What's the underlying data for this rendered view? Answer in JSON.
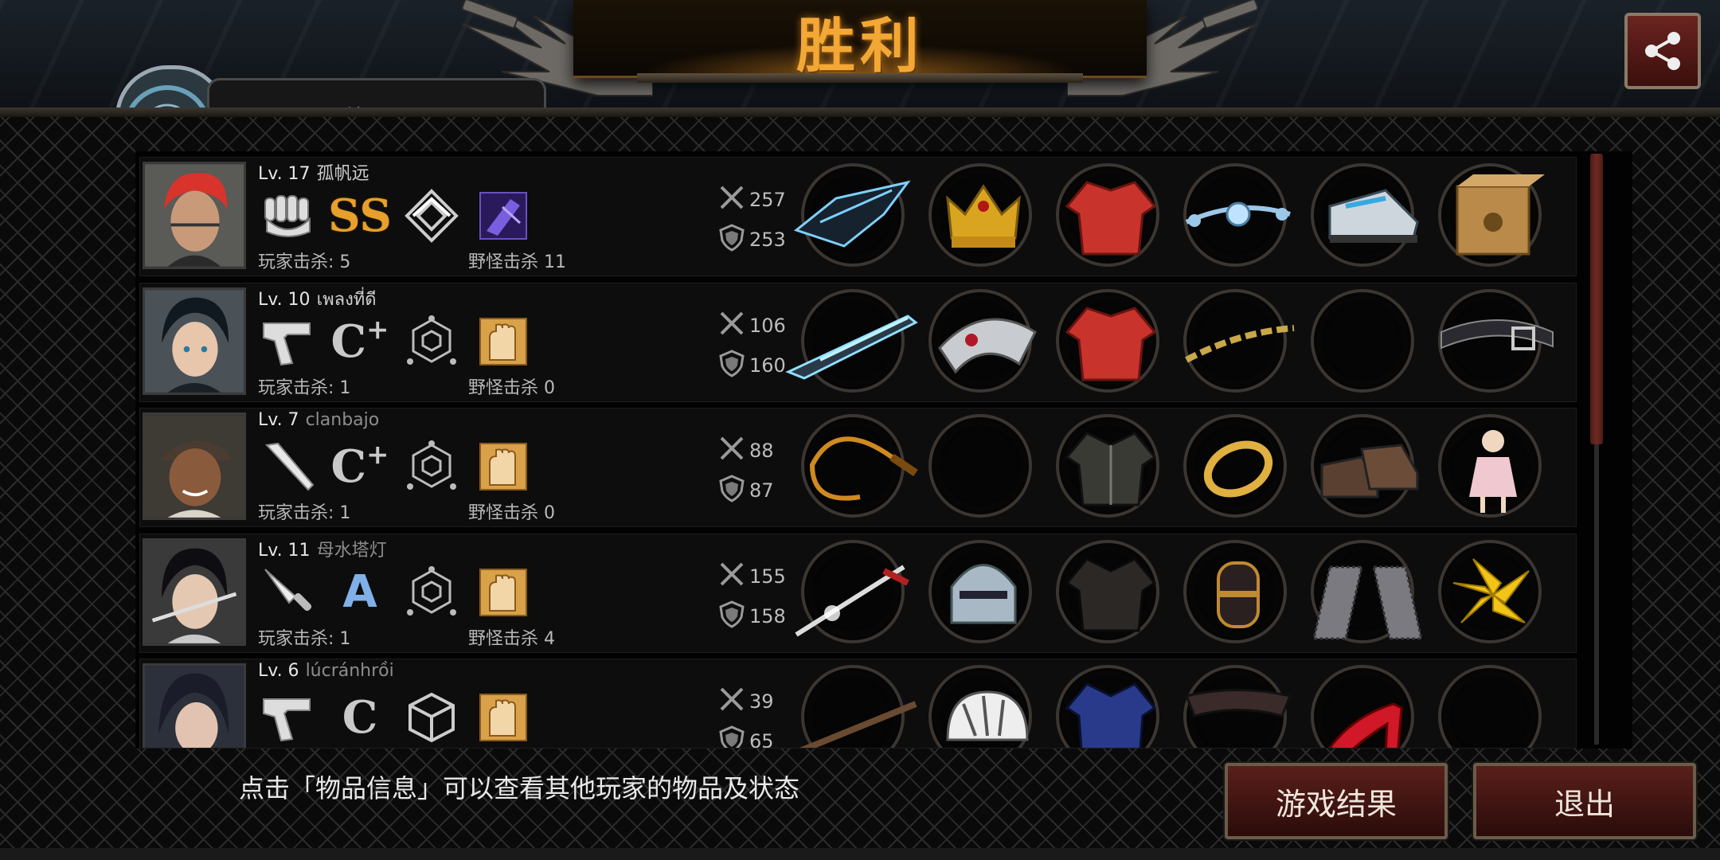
{
  "header": {
    "title": "胜利",
    "share_icon": "share-icon",
    "badge_name_partial": "孤帆远"
  },
  "players": [
    {
      "level": "Lv. 17",
      "name": "孤帆远",
      "weapon_icon": "fist-icon",
      "grade": "SS",
      "grade_sup": "",
      "grade_style": "ss",
      "rank_icon": "rank-diamond-icon",
      "skill_icon": "skill-purple-icon",
      "player_kills": "玩家击杀: 5",
      "monster_kills": "野怪击杀 11",
      "attack": "257",
      "defense": "253",
      "items": [
        "gauntlet-item-icon",
        "crown-item-icon",
        "red-shirt-item-icon",
        "orb-necklace-item-icon",
        "boots-item-icon",
        "cat-box-item-icon"
      ]
    },
    {
      "level": "Lv. 10",
      "name": "เพลงที่ดี",
      "weapon_icon": "pistol-icon",
      "grade": "C",
      "grade_sup": "+",
      "grade_style": "c",
      "rank_icon": "rank-hexagon-icon",
      "skill_icon": "skill-hand-icon",
      "player_kills": "玩家击杀: 1",
      "monster_kills": "野怪击杀 0",
      "attack": "106",
      "defense": "160",
      "items": [
        "laser-rifle-item-icon",
        "tiara-item-icon",
        "red-shirt-item-icon",
        "chain-item-icon",
        "",
        "belt-item-icon"
      ]
    },
    {
      "level": "Lv. 7",
      "name": "clanbajo",
      "weapon_icon": "bat-icon",
      "grade": "C",
      "grade_sup": "+",
      "grade_style": "c",
      "rank_icon": "rank-hexagon-icon",
      "skill_icon": "skill-hand-icon",
      "player_kills": "玩家击杀: 1",
      "monster_kills": "野怪击杀 0",
      "attack": "88",
      "defense": "87",
      "items": [
        "whip-item-icon",
        "",
        "jacket-item-icon",
        "bracelet-item-icon",
        "shoes-item-icon",
        "doll-item-icon"
      ]
    },
    {
      "level": "Lv. 11",
      "name": "母水塔灯",
      "weapon_icon": "knife-icon",
      "grade": "A",
      "grade_sup": "",
      "grade_style": "a",
      "rank_icon": "rank-hexagon-icon",
      "skill_icon": "skill-hand-icon",
      "player_kills": "玩家击杀: 1",
      "monster_kills": "野怪击杀 4",
      "attack": "155",
      "defense": "158",
      "items": [
        "sword-item-icon",
        "helmet-item-icon",
        "leather-jacket-item-icon",
        "vambrace-item-icon",
        "chain-leggings-item-icon",
        "lily-item-icon"
      ]
    },
    {
      "level": "Lv. 6",
      "name": "lúcránhrồi",
      "weapon_icon": "pistol-icon",
      "grade": "C",
      "grade_sup": "",
      "grade_style": "c",
      "rank_icon": "rank-cube-icon",
      "skill_icon": "skill-hand-icon",
      "player_kills": "",
      "monster_kills": "",
      "attack": "39",
      "defense": "65",
      "items": [
        "musket-item-icon",
        "bike-helmet-item-icon",
        "blue-jacket-item-icon",
        "mask-item-icon",
        "high-heels-item-icon",
        ""
      ]
    }
  ],
  "footer": {
    "hint": "点击「物品信息」可以查看其他玩家的物品及状态",
    "result_button": "游戏结果",
    "exit_button": "退出"
  },
  "colors": {
    "title": "#f3a836",
    "button_red": "#5a1f1a",
    "ss_gold": "#e7a02b",
    "a_blue": "#7fb0e8"
  }
}
